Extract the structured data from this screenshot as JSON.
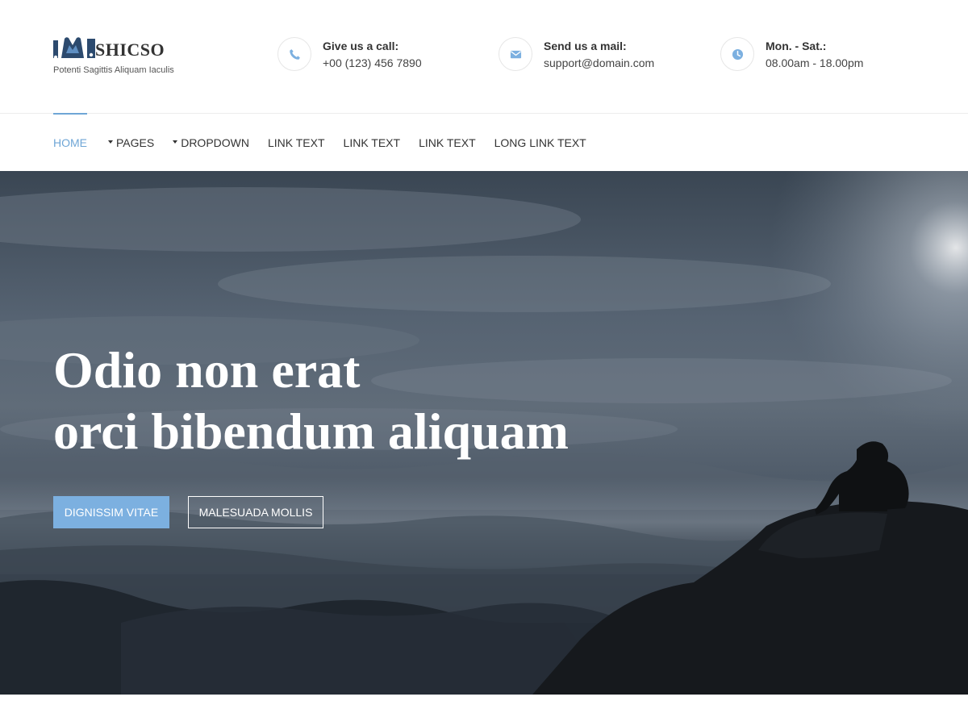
{
  "brand": {
    "name": "SHICSO",
    "tagline": "Potenti Sagittis Aliquam Iaculis"
  },
  "contacts": {
    "call": {
      "label": "Give us a call:",
      "value": "+00 (123) 456 7890",
      "icon": "phone-icon"
    },
    "mail": {
      "label": "Send us a mail:",
      "value": "support@domain.com",
      "icon": "envelope-icon"
    },
    "hours": {
      "label": "Mon. - Sat.:",
      "value": "08.00am - 18.00pm",
      "icon": "clock-icon"
    }
  },
  "nav": {
    "items": [
      {
        "label": "Home",
        "active": true,
        "dropdown": false
      },
      {
        "label": "Pages",
        "active": false,
        "dropdown": true
      },
      {
        "label": "Dropdown",
        "active": false,
        "dropdown": true
      },
      {
        "label": "Link Text",
        "active": false,
        "dropdown": false
      },
      {
        "label": "Link Text",
        "active": false,
        "dropdown": false
      },
      {
        "label": "Link Text",
        "active": false,
        "dropdown": false
      },
      {
        "label": "Long Link Text",
        "active": false,
        "dropdown": false
      }
    ]
  },
  "hero": {
    "title_line1": "Odio non erat",
    "title_line2": "orci bibendum aliquam",
    "primary_button": "Dignissim Vitae",
    "secondary_button": "Malesuada Mollis"
  },
  "colors": {
    "accent": "#6fa6d6",
    "button_primary": "#7cb0e0",
    "text": "#333333",
    "border": "#ececec"
  }
}
